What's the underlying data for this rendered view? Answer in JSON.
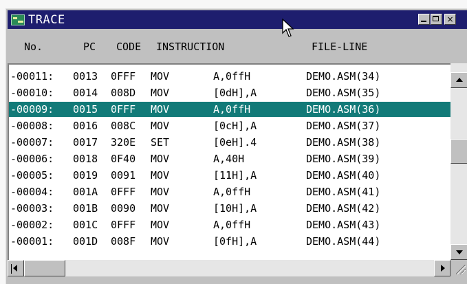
{
  "window": {
    "title": "TRACE",
    "icon": "trace-window-icon",
    "controls": {
      "minimize": "minimize-icon",
      "maximize": "maximize-icon",
      "close": "×"
    }
  },
  "header": {
    "no": "No.",
    "pc": "PC",
    "code": "CODE",
    "instruction": "INSTRUCTION",
    "file_line": "FILE-LINE"
  },
  "rows": [
    {
      "no": "-00011:",
      "pc": "0013",
      "code": "0FFF",
      "mnemonic": "MOV",
      "operand": "A,0ffH",
      "file": "DEMO.ASM(34)"
    },
    {
      "no": "-00010:",
      "pc": "0014",
      "code": "008D",
      "mnemonic": "MOV",
      "operand": "[0dH],A",
      "file": "DEMO.ASM(35)"
    },
    {
      "no": "-00009:",
      "pc": "0015",
      "code": "0FFF",
      "mnemonic": "MOV",
      "operand": "A,0ffH",
      "file": "DEMO.ASM(36)"
    },
    {
      "no": "-00008:",
      "pc": "0016",
      "code": "008C",
      "mnemonic": "MOV",
      "operand": "[0cH],A",
      "file": "DEMO.ASM(37)"
    },
    {
      "no": "-00007:",
      "pc": "0017",
      "code": "320E",
      "mnemonic": "SET",
      "operand": "[0eH].4",
      "file": "DEMO.ASM(38)"
    },
    {
      "no": "-00006:",
      "pc": "0018",
      "code": "0F40",
      "mnemonic": "MOV",
      "operand": "A,40H",
      "file": "DEMO.ASM(39)"
    },
    {
      "no": "-00005:",
      "pc": "0019",
      "code": "0091",
      "mnemonic": "MOV",
      "operand": "[11H],A",
      "file": "DEMO.ASM(40)"
    },
    {
      "no": "-00004:",
      "pc": "001A",
      "code": "0FFF",
      "mnemonic": "MOV",
      "operand": "A,0ffH",
      "file": "DEMO.ASM(41)"
    },
    {
      "no": "-00003:",
      "pc": "001B",
      "code": "0090",
      "mnemonic": "MOV",
      "operand": "[10H],A",
      "file": "DEMO.ASM(42)"
    },
    {
      "no": "-00002:",
      "pc": "001C",
      "code": "0FFF",
      "mnemonic": "MOV",
      "operand": "A,0ffH",
      "file": "DEMO.ASM(43)"
    },
    {
      "no": "-00001:",
      "pc": "001D",
      "code": "008F",
      "mnemonic": "MOV",
      "operand": "[0fH],A",
      "file": "DEMO.ASM(44)"
    }
  ],
  "selected_row": 2,
  "colors": {
    "titlebar": "#1e1e6e",
    "selection": "#127a78",
    "face": "#c0c0c0"
  }
}
